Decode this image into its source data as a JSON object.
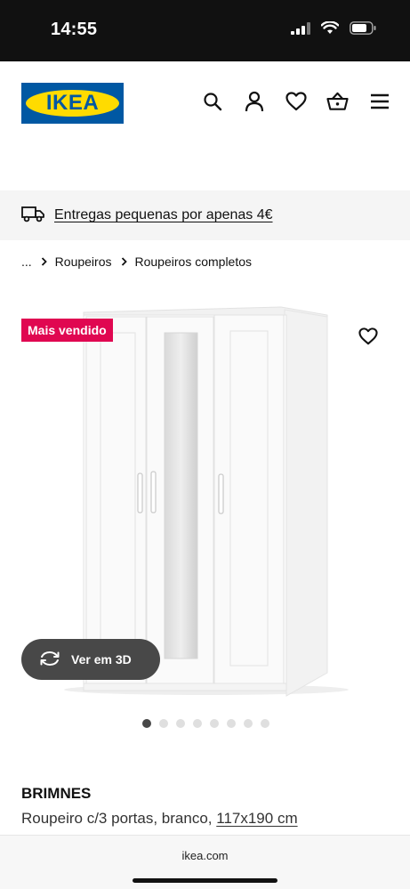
{
  "status_bar": {
    "time": "14:55"
  },
  "header": {
    "logo_text": "IKEA",
    "icons": [
      "search-icon",
      "user-icon",
      "heart-icon",
      "basket-icon",
      "menu-icon"
    ]
  },
  "delivery": {
    "text": "Entregas pequenas por apenas 4€",
    "icon": "truck-icon"
  },
  "breadcrumb": {
    "ellipsis": "...",
    "items": [
      "Roupeiros",
      "Roupeiros completos"
    ]
  },
  "product": {
    "badge": "Mais vendido",
    "view_3d_label": "Ver em 3D",
    "name": "BRIMNES",
    "description": "Roupeiro c/3 portas, branco,",
    "dimensions": "117x190 cm",
    "image_count": 8,
    "active_image_index": 0
  },
  "browser": {
    "url": "ikea.com"
  },
  "colors": {
    "status_bar_bg": "#111111",
    "ikea_blue": "#0058a3",
    "ikea_yellow": "#ffdb00",
    "badge_red": "#e00751",
    "button_dark": "#484848"
  }
}
